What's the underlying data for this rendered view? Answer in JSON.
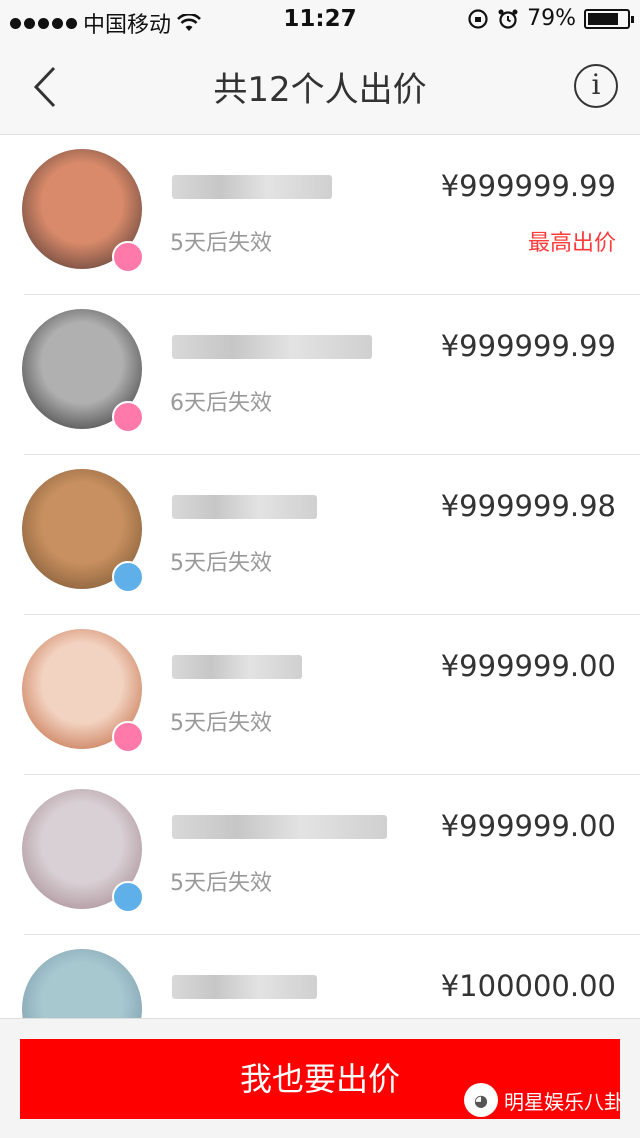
{
  "status_bar": {
    "carrier": "中国移动",
    "time": "11:27",
    "battery": "79%",
    "battery_level": 0.79
  },
  "nav": {
    "title": "共12个人出价",
    "info_glyph": "i"
  },
  "bids": [
    {
      "price": "¥999999.99",
      "expire": "5天后失效",
      "tag": "最高出价",
      "badge_color": "#ff7aa8",
      "avatar_colors": [
        "#d88a6a",
        "#3a2a2a"
      ]
    },
    {
      "price": "¥999999.99",
      "expire": "6天后失效",
      "tag": "",
      "badge_color": "#ff7aa8",
      "avatar_colors": [
        "#b0b0b0",
        "#1f1f1f"
      ]
    },
    {
      "price": "¥999999.98",
      "expire": "5天后失效",
      "tag": "",
      "badge_color": "#5fb0e8",
      "avatar_colors": [
        "#c89060",
        "#6b4a2a"
      ]
    },
    {
      "price": "¥999999.00",
      "expire": "5天后失效",
      "tag": "",
      "badge_color": "#ff7aa8",
      "avatar_colors": [
        "#f2d2c0",
        "#b8552a"
      ]
    },
    {
      "price": "¥999999.00",
      "expire": "5天后失效",
      "tag": "",
      "badge_color": "#5fb0e8",
      "avatar_colors": [
        "#d8d0d4",
        "#9a7a82"
      ]
    },
    {
      "price": "¥100000.00",
      "expire": "",
      "tag": "",
      "badge_color": "",
      "avatar_colors": [
        "#a8c8d0",
        "#6a8aa0"
      ]
    }
  ],
  "bottom": {
    "button_label": "我也要出价",
    "watermark": "明星娱乐八卦"
  },
  "colors": {
    "accent_red": "#ff0000",
    "highlight_text": "#ff3b3b"
  }
}
